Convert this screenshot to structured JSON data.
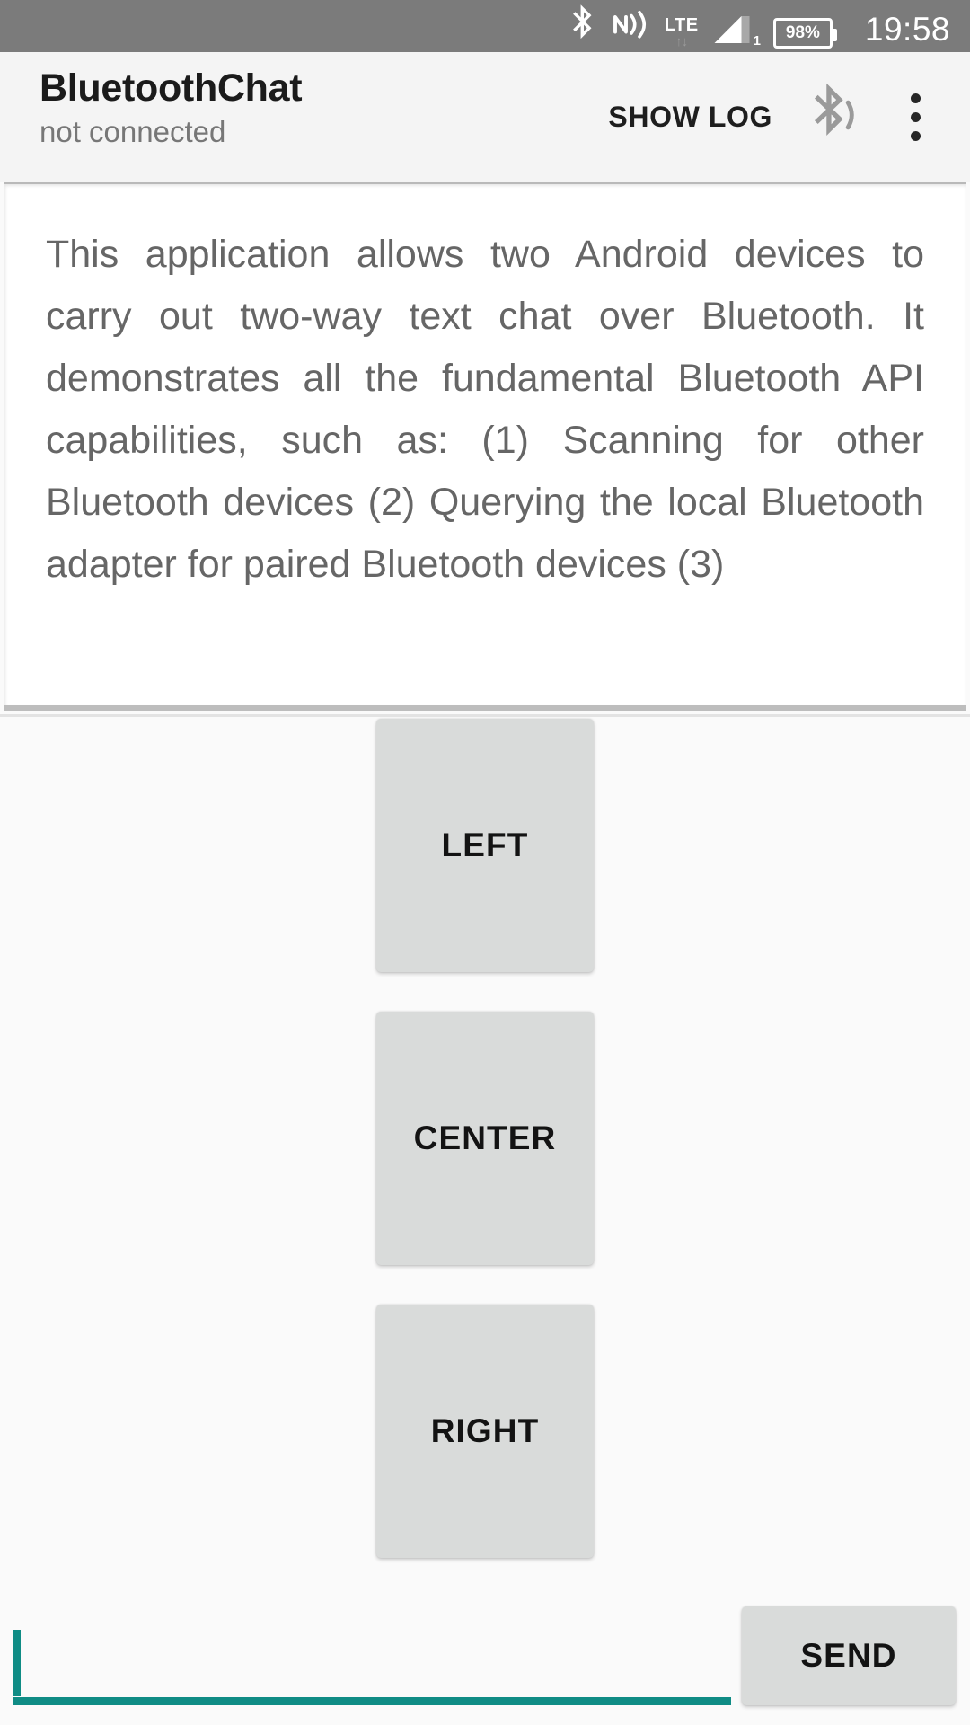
{
  "status_bar": {
    "bluetooth_icon": "bluetooth-icon",
    "nfc_icon": "nfc-signal-icon",
    "network_type": "LTE",
    "data_arrows": "↑↓",
    "signal_icon": "signal-bars-icon",
    "sim_slot": "1",
    "battery_percent": "98%",
    "time": "19:58",
    "background_color": "#7b7b7b"
  },
  "app_bar": {
    "title": "BluetoothChat",
    "subtitle": "not connected",
    "show_log_label": "SHOW LOG",
    "bluetooth_audio_icon": "bluetooth-audio-icon",
    "overflow_icon": "overflow-menu-icon",
    "background_color": "#f4f4f4"
  },
  "content": {
    "description": "This application allows two Android devices to carry out two-way text chat over Bluetooth. It demonstrates all the fundamental Bluetooth API capabilities, such as: (1) Scanning for other Bluetooth devices (2) Querying the local Bluetooth adapter for paired Bluetooth devices (3)"
  },
  "direction_buttons": [
    {
      "label": "LEFT"
    },
    {
      "label": "CENTER"
    },
    {
      "label": "RIGHT"
    }
  ],
  "composer": {
    "input_value": "",
    "input_placeholder": "",
    "send_label": "SEND",
    "accent_color": "#0f8c85",
    "button_color": "#d9dbda"
  }
}
